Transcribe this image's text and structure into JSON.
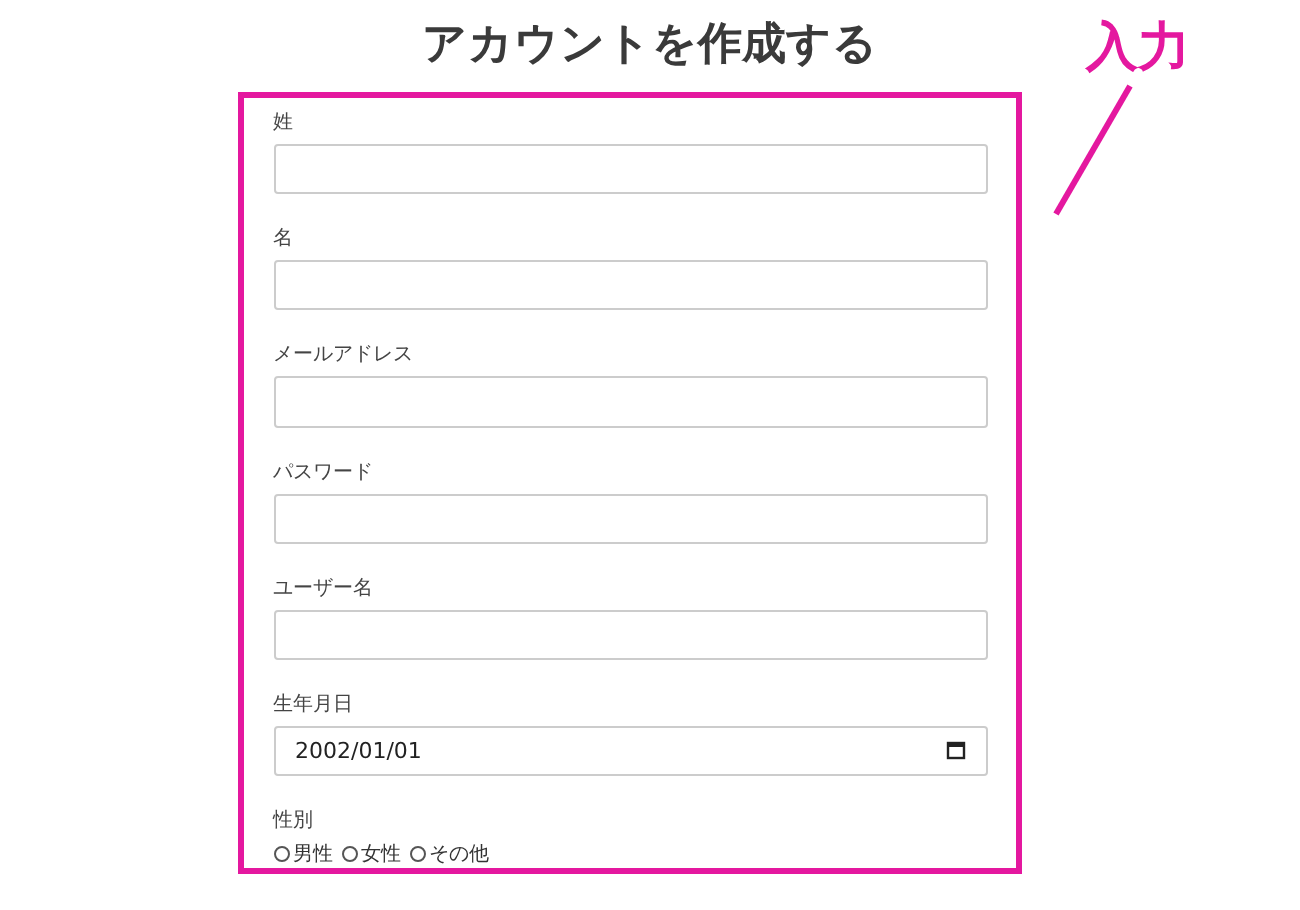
{
  "title": "アカウントを作成する",
  "callout": {
    "label": "入力"
  },
  "fields": [
    {
      "label": "姓",
      "kind": "text"
    },
    {
      "label": "名",
      "kind": "text"
    },
    {
      "label": "メールアドレス",
      "kind": "text"
    },
    {
      "label": "パスワード",
      "kind": "text"
    },
    {
      "label": "ユーザー名",
      "kind": "text"
    },
    {
      "label": "生年月日",
      "kind": "date",
      "value": "2002/01/01"
    }
  ],
  "gender": {
    "label": "性別",
    "options": [
      {
        "label": "男性",
        "selected": false
      },
      {
        "label": "女性",
        "selected": false
      },
      {
        "label": "その他",
        "selected": false
      }
    ]
  }
}
